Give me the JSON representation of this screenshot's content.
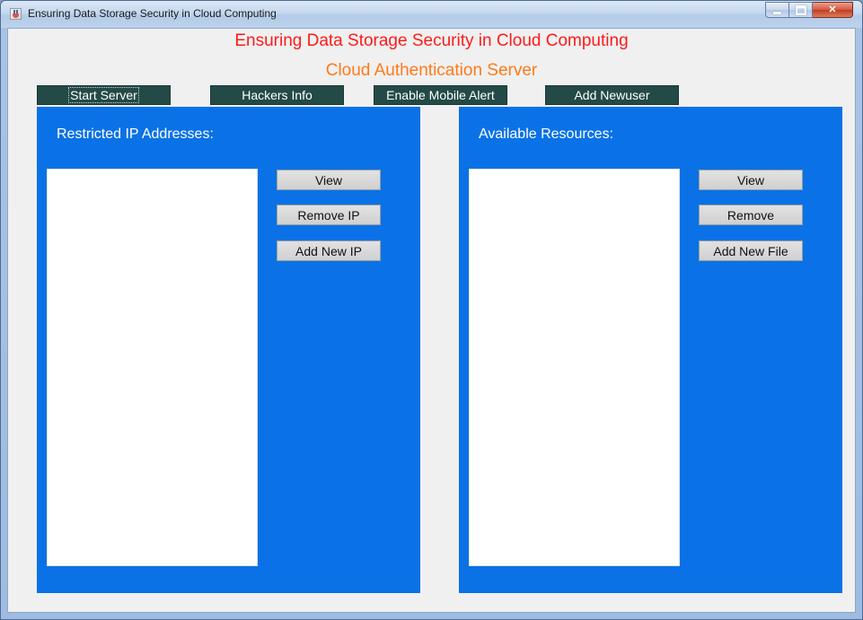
{
  "window": {
    "title": "Ensuring Data Storage Security in Cloud Computing",
    "icon": "java-cup-icon"
  },
  "header": {
    "title": "Ensuring Data Storage Security in Cloud Computing",
    "subtitle": "Cloud Authentication Server",
    "title_color": "#ff1a1a",
    "subtitle_color": "#ff7a1a"
  },
  "toolbar": {
    "start_server": "Start Server",
    "hackers_info": "Hackers Info",
    "enable_mobile_alert": "Enable Mobile Alert",
    "add_newuser": "Add Newuser"
  },
  "restricted_ip_panel": {
    "label": "Restricted IP Addresses:",
    "items": [],
    "view": "View",
    "remove": "Remove IP",
    "add": "Add New IP"
  },
  "resources_panel": {
    "label": "Available Resources:",
    "items": [],
    "view": "View",
    "remove": "Remove",
    "add": "Add New File"
  },
  "colors": {
    "panel_blue": "#0a72e6",
    "toolbar_button": "#234a47",
    "client_background": "#f0f0f0"
  }
}
